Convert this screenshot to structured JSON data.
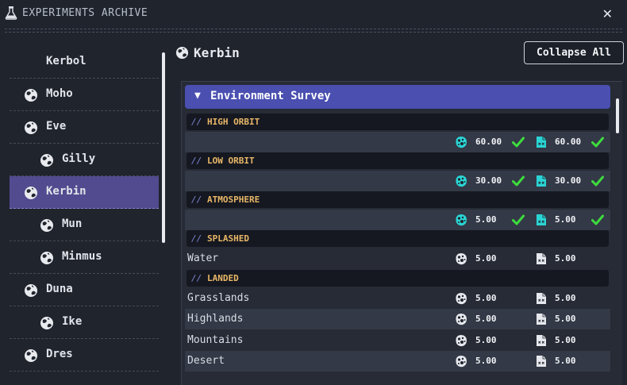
{
  "window": {
    "title": "EXPERIMENTS ARCHIVE",
    "close_glyph": "✕"
  },
  "sidebar": {
    "items": [
      {
        "label": "Kerbol",
        "icon": "none"
      },
      {
        "label": "Moho",
        "icon": "planet-icon"
      },
      {
        "label": "Eve",
        "icon": "planet-icon"
      },
      {
        "label": "Gilly",
        "icon": "planet-icon"
      },
      {
        "label": "Kerbin",
        "icon": "planet-icon",
        "selected": true
      },
      {
        "label": "Mun",
        "icon": "planet-icon"
      },
      {
        "label": "Minmus",
        "icon": "planet-icon"
      },
      {
        "label": "Duna",
        "icon": "planet-icon"
      },
      {
        "label": "Ike",
        "icon": "planet-icon"
      },
      {
        "label": "Dres",
        "icon": "planet-icon"
      }
    ]
  },
  "main": {
    "title": "Kerbin",
    "collapse_label": "Collapse All",
    "section": {
      "arrow": "▼",
      "title": "Environment Survey",
      "groups": [
        {
          "slashes": "//",
          "name": "HIGH ORBIT",
          "rows": [
            {
              "label": "",
              "science": "60.00",
              "data": "60.00",
              "done": true
            }
          ]
        },
        {
          "slashes": "//",
          "name": "LOW ORBIT",
          "rows": [
            {
              "label": "",
              "science": "30.00",
              "data": "30.00",
              "done": true
            }
          ]
        },
        {
          "slashes": "//",
          "name": "ATMOSPHERE",
          "rows": [
            {
              "label": "",
              "science": "5.00",
              "data": "5.00",
              "done": true
            }
          ]
        },
        {
          "slashes": "//",
          "name": "SPLASHED",
          "rows": [
            {
              "label": "Water",
              "science": "5.00",
              "data": "5.00",
              "done": false
            }
          ]
        },
        {
          "slashes": "//",
          "name": "LANDED",
          "rows": [
            {
              "label": "Grasslands",
              "science": "5.00",
              "data": "5.00",
              "done": false
            },
            {
              "label": "Highlands",
              "science": "5.00",
              "data": "5.00",
              "done": false
            },
            {
              "label": "Mountains",
              "science": "5.00",
              "data": "5.00",
              "done": false
            },
            {
              "label": "Desert",
              "science": "5.00",
              "data": "5.00",
              "done": false
            }
          ]
        }
      ]
    }
  },
  "colors": {
    "accent": "#4a4fb0",
    "selected": "#524b8f",
    "group_name": "#e9b768",
    "done_icon": "#2ad4d4",
    "check": "#3ddc3d",
    "pending_icon": "#e6e8ee"
  }
}
